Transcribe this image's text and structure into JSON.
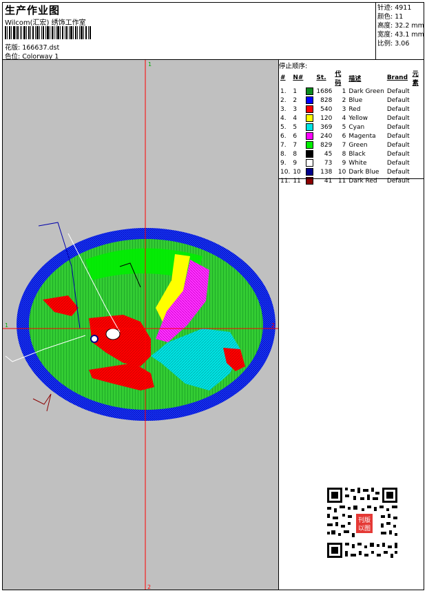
{
  "header": {
    "title": "生产作业图",
    "subtitle": "Wilcom(汇宏) 绣饰工作室",
    "pattern": "花版: 166637.dst",
    "colorway": "色位: Colorway 1"
  },
  "stats": {
    "stitches": "针迹: 4911",
    "colors": "颜色: 11",
    "height": "高度: 32.2 mm",
    "width": "宽度: 43.1 mm",
    "ratio": "比例: 3.06"
  },
  "stop_sequence": {
    "title": "停止顺序:",
    "headers": [
      "#",
      "N#",
      "",
      "St.",
      "代码",
      "描述",
      "Brand",
      "元素"
    ],
    "rows": [
      {
        "idx": "1.",
        "n": "1",
        "color": "#0b8a1e",
        "st": "1686",
        "code": "1",
        "desc": "Dark Green",
        "brand": "Default"
      },
      {
        "idx": "2.",
        "n": "2",
        "color": "#0000ff",
        "st": "828",
        "code": "2",
        "desc": "Blue",
        "brand": "Default"
      },
      {
        "idx": "3.",
        "n": "3",
        "color": "#ff0000",
        "st": "540",
        "code": "3",
        "desc": "Red",
        "brand": "Default"
      },
      {
        "idx": "4.",
        "n": "4",
        "color": "#ffff00",
        "st": "120",
        "code": "4",
        "desc": "Yellow",
        "brand": "Default"
      },
      {
        "idx": "5.",
        "n": "5",
        "color": "#00e5e5",
        "st": "369",
        "code": "5",
        "desc": "Cyan",
        "brand": "Default"
      },
      {
        "idx": "6.",
        "n": "6",
        "color": "#ff00ff",
        "st": "240",
        "code": "6",
        "desc": "Magenta",
        "brand": "Default"
      },
      {
        "idx": "7.",
        "n": "7",
        "color": "#00ee00",
        "st": "829",
        "code": "7",
        "desc": "Green",
        "brand": "Default"
      },
      {
        "idx": "8.",
        "n": "8",
        "color": "#000000",
        "st": "45",
        "code": "8",
        "desc": "Black",
        "brand": "Default"
      },
      {
        "idx": "9.",
        "n": "9",
        "color": "#ffffff",
        "st": "73",
        "code": "9",
        "desc": "White",
        "brand": "Default"
      },
      {
        "idx": "10.",
        "n": "10",
        "color": "#00008b",
        "st": "138",
        "code": "10",
        "desc": "Dark Blue",
        "brand": "Default"
      },
      {
        "idx": "11.",
        "n": "11",
        "color": "#8b0000",
        "st": "41",
        "code": "11",
        "desc": "Dark Red",
        "brand": "Default"
      }
    ]
  },
  "crosshair": {
    "top_label": "1",
    "bottom_label": "2",
    "left_label": "1",
    "right_label": "2"
  },
  "qr_stamp": {
    "text_top": "刊版",
    "text_bottom": "以图"
  }
}
